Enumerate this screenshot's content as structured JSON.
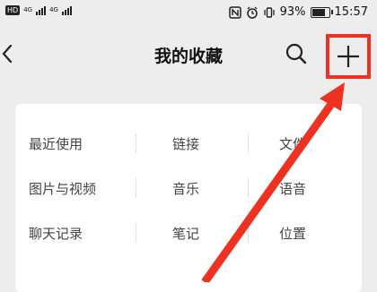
{
  "status_bar": {
    "left_badge": "HD",
    "network_1": "4G",
    "network_2": "4G",
    "battery_percent": "93%",
    "battery_level": 0.93,
    "time": "15:57",
    "icons": [
      "nfc-icon",
      "alarm-icon",
      "vibrate-icon",
      "battery-icon"
    ]
  },
  "nav": {
    "title": "我的收藏",
    "back_icon": "chevron-left-icon",
    "search_icon": "search-icon",
    "add_icon": "plus-icon"
  },
  "categories": [
    [
      "最近使用",
      "链接",
      "文件"
    ],
    [
      "图片与视频",
      "音乐",
      "语音"
    ],
    [
      "聊天记录",
      "笔记",
      "位置"
    ]
  ],
  "annotation": {
    "highlight_color": "#ee3222",
    "arrow_color": "#ee3222"
  }
}
